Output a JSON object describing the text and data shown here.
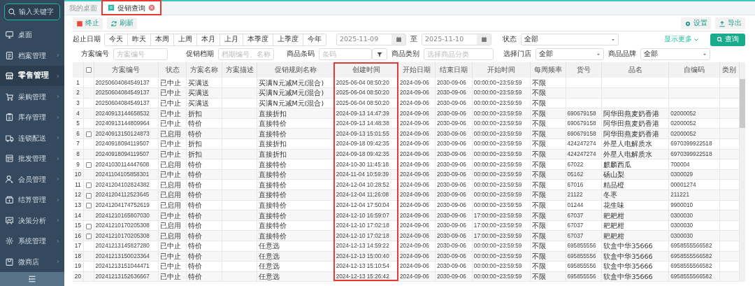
{
  "sidebar": {
    "search": {
      "placeholder": "输入关键字"
    },
    "items": [
      {
        "label": "桌面",
        "selected": false,
        "arrow": false
      },
      {
        "label": "档案管理",
        "selected": false,
        "arrow": true
      },
      {
        "label": "零售管理",
        "selected": true,
        "arrow": true
      },
      {
        "label": "采购管理",
        "selected": false,
        "arrow": true
      },
      {
        "label": "库存管理",
        "selected": false,
        "arrow": true
      },
      {
        "label": "连锁配送",
        "selected": false,
        "arrow": true
      },
      {
        "label": "批发管理",
        "selected": false,
        "arrow": true
      },
      {
        "label": "会员管理",
        "selected": false,
        "arrow": true
      },
      {
        "label": "结算管理",
        "selected": false,
        "arrow": true
      },
      {
        "label": "决策分析",
        "selected": false,
        "arrow": true
      },
      {
        "label": "系统管理",
        "selected": false,
        "arrow": true
      },
      {
        "label": "微商店",
        "selected": false,
        "arrow": true
      }
    ]
  },
  "tabs": [
    {
      "label": "我的桌面",
      "selected": false,
      "closable": false,
      "highlighted": false
    },
    {
      "label": "促销查询",
      "selected": true,
      "closable": true,
      "highlighted": true
    }
  ],
  "toolbar": {
    "left": [
      {
        "label": "终止",
        "kind": "stop"
      },
      {
        "label": "刷新",
        "kind": "refresh"
      }
    ],
    "right": [
      {
        "label": "设置",
        "kind": "settings"
      },
      {
        "label": "导出",
        "kind": "export"
      }
    ]
  },
  "filters": {
    "date_label": "起止日期",
    "quick_ranges": [
      "今天",
      "昨天",
      "本周",
      "上周",
      "本月",
      "上月",
      "本季度",
      "上季度",
      "今年"
    ],
    "date_from": "2025-11-09",
    "date_sep": "至",
    "date_to": "2025-11-10",
    "status_label": "状态",
    "status_value": "全部",
    "more_link": "显示更多",
    "search_button": "查询",
    "plan_label": "方案编号",
    "plan_placeholder": "方案编号",
    "period_label": "促销档期",
    "period_placeholder": "档期编号、名称",
    "barcode_label": "商品条码",
    "barcode_placeholder": "条码",
    "category_label": "商品类别",
    "category_placeholder": "选择商品分类",
    "store_label": "选择门店",
    "store_value": "全部",
    "brand_label": "商品品牌",
    "brand_value": "全部"
  },
  "table": {
    "select_all_checked": false,
    "columns": [
      {
        "label": "方案编号",
        "kind": "code",
        "highlighted": false
      },
      {
        "label": "状态",
        "kind": "text",
        "highlighted": false
      },
      {
        "label": "方案名称",
        "kind": "text",
        "highlighted": false
      },
      {
        "label": "方案描述",
        "kind": "text",
        "highlighted": false
      },
      {
        "label": "促销规则名称",
        "kind": "text",
        "highlighted": false
      },
      {
        "label": "创建时间",
        "kind": "code",
        "highlighted": true
      },
      {
        "label": "开始日期",
        "kind": "code",
        "highlighted": false
      },
      {
        "label": "结束日期",
        "kind": "code",
        "highlighted": false
      },
      {
        "label": "开始时间",
        "kind": "code",
        "highlighted": false
      },
      {
        "label": "每周频率",
        "kind": "text",
        "highlighted": false
      },
      {
        "label": "货号",
        "kind": "code",
        "highlighted": false
      },
      {
        "label": "品名",
        "kind": "text",
        "highlighted": false
      },
      {
        "label": "自编码",
        "kind": "code",
        "highlighted": false
      },
      {
        "label": "类别",
        "kind": "text",
        "highlighted": false
      }
    ],
    "rows": [
      {
        "no": "1",
        "cells": [
          "20250604084549137",
          "已中止",
          "买满送",
          "",
          "买满N元减M元(混合)",
          "2025-06-04 08:50:20",
          "2024-09-06",
          "2030-09-06",
          "00:00:00~23:59:59",
          "不限",
          "",
          "",
          "",
          ""
        ]
      },
      {
        "no": "2",
        "cells": [
          "20250604084549137",
          "已中止",
          "买满送",
          "",
          "买满N元减M元(混合)",
          "2025-06-04 08:50:20",
          "2024-09-06",
          "2030-09-06",
          "00:00:00~23:59:59",
          "不限",
          "",
          "",
          "",
          ""
        ]
      },
      {
        "no": "3",
        "cells": [
          "20250604084549137",
          "已中止",
          "买满送",
          "",
          "买满N元减M元(混合)",
          "2025-06-04 08:50:20",
          "2024-09-06",
          "2030-09-06",
          "00:00:00~23:59:59",
          "不限",
          "",
          "",
          "",
          ""
        ]
      },
      {
        "no": "4",
        "cells": [
          "20240913144658532",
          "已中止",
          "折扣",
          "",
          "直接折扣",
          "2024-09-13 14:47:39",
          "2024-09-06",
          "2030-09-06",
          "00:00:00~23:59:59",
          "不限",
          "690679158",
          "阿华田燕麦奶香港",
          "02000052",
          ""
        ]
      },
      {
        "no": "5",
        "cells": [
          "20240913144809964",
          "已中止",
          "特价",
          "",
          "直接特价",
          "2024-09-13 14:48:38",
          "2024-09-06",
          "2030-09-06",
          "00:00:00~23:59:59",
          "不限",
          "690679158",
          "阿华田燕麦奶香港",
          "02000052",
          ""
        ]
      },
      {
        "no": "6",
        "checked": false,
        "cells": [
          "20240913150124873",
          "已启用",
          "特价",
          "",
          "直接特价",
          "2024-09-13 15:01:55",
          "2024-09-06",
          "2030-09-06",
          "00:00:00~23:59:59",
          "不限",
          "690679158",
          "阿华田燕麦奶香港",
          "02000052",
          ""
        ]
      },
      {
        "no": "7",
        "cells": [
          "20240918094119507",
          "已中止",
          "折扣",
          "",
          "直接折扣",
          "2024-09-18 09:42:35",
          "2024-09-06",
          "2030-09-06",
          "00:00:00~23:59:59",
          "不限",
          "424247274",
          "外星人电解质水",
          "6970399922518",
          ""
        ]
      },
      {
        "no": "8",
        "cells": [
          "20240918094119507",
          "已中止",
          "折扣",
          "",
          "直接折扣",
          "2024-09-18 09:42:35",
          "2024-09-06",
          "2030-09-06",
          "00:00:00~23:59:59",
          "不限",
          "424247274",
          "外星人电解质水",
          "6970399922518",
          ""
        ]
      },
      {
        "no": "9",
        "checked": false,
        "cells": [
          "20241030114447608",
          "已启用",
          "特价",
          "",
          "直接特价",
          "2024-10-30 11:45:18",
          "2024-09-06",
          "2030-09-06",
          "00:00:00~23:59:59",
          "不限",
          "67022",
          "麒麟西瓜",
          "700004",
          ""
        ]
      },
      {
        "no": "10",
        "cells": [
          "20241104105858301",
          "已中止",
          "特价",
          "",
          "直接特价",
          "2024-11-04 10:59:39",
          "2024-09-06",
          "2030-09-06",
          "00:00:00~23:59:59",
          "不限",
          "05162",
          "砀山梨",
          "0300029",
          ""
        ]
      },
      {
        "no": "11",
        "checked": false,
        "cells": [
          "20241204102824382",
          "已启用",
          "特价",
          "",
          "直接特价",
          "2024-12-04 10:28:52",
          "2024-09-06",
          "2030-09-06",
          "00:00:00~23:59:59",
          "不限",
          "67016",
          "精品橙",
          "00001274",
          ""
        ]
      },
      {
        "no": "12",
        "checked": false,
        "cells": [
          "20241204112523645",
          "已启用",
          "特价",
          "",
          "直接特价",
          "2024-12-04 11:26:08",
          "2024-09-06",
          "2030-09-06",
          "00:00:00~23:59:59",
          "不限",
          "21122",
          "冬枣",
          "211221",
          ""
        ]
      },
      {
        "no": "13",
        "checked": false,
        "cells": [
          "20241204174752619",
          "已启用",
          "特价",
          "",
          "直接特价",
          "2024-12-04 17:50:04",
          "2024-09-06",
          "2030-09-06",
          "00:00:00~23:59:59",
          "不限",
          "01244",
          "花生味",
          "9900010",
          ""
        ]
      },
      {
        "no": "14",
        "cells": [
          "20241210165807030",
          "已中止",
          "特价",
          "",
          "直接特价",
          "2024-12-10 16:59:07",
          "2024-09-06",
          "2030-09-06",
          "17:00:00~23:59:59",
          "不限",
          "67037",
          "耙耙柑",
          "0300030",
          ""
        ]
      },
      {
        "no": "15",
        "checked": false,
        "cells": [
          "20241210170205308",
          "已启用",
          "特价",
          "",
          "直接特价",
          "2024-12-10 17:02:18",
          "2024-09-06",
          "2030-09-06",
          "17:00:00~23:59:59",
          "不限",
          "67037",
          "耙耙柑",
          "0300030",
          ""
        ]
      },
      {
        "no": "16",
        "checked": false,
        "cells": [
          "20241210170205308",
          "已启用",
          "特价",
          "",
          "直接特价",
          "2024-12-10 17:02:18",
          "2024-09-06",
          "2030-09-06",
          "17:00:00~23:59:59",
          "不限",
          "67037",
          "耙耙柑",
          "0300030",
          ""
        ]
      },
      {
        "no": "17",
        "cells": [
          "20241213145827280",
          "已中止",
          "特价",
          "",
          "任意选",
          "2024-12-13 14:59:22",
          "2024-09-06",
          "2030-09-06",
          "00:00:00~23:59:59",
          "不限",
          "695855556",
          "软盒中华35666",
          "6958555566582",
          ""
        ]
      },
      {
        "no": "18",
        "cells": [
          "20241213150023364",
          "已中止",
          "特价",
          "",
          "任意选",
          "2024-12-13 15:00:40",
          "2024-09-06",
          "2030-09-06",
          "00:00:00~23:59:59",
          "不限",
          "695855556",
          "软盒中华35666",
          "6958555566582",
          ""
        ]
      },
      {
        "no": "19",
        "cells": [
          "20241213151044471",
          "已中止",
          "特价",
          "",
          "任意选",
          "2024-12-13 15:10:54",
          "2024-09-06",
          "2030-09-06",
          "00:00:00~23:59:59",
          "不限",
          "695855556",
          "软盒中华35666",
          "6958555566582",
          ""
        ]
      },
      {
        "no": "20",
        "cells": [
          "20241213152636667",
          "已中止",
          "特价",
          "",
          "任意选",
          "2024-12-13 15:26:42",
          "2024-09-06",
          "2030-09-06",
          "00:00:00~23:59:59",
          "不限",
          "695855556",
          "软盒中华35666",
          "6958555566582",
          ""
        ]
      }
    ]
  }
}
